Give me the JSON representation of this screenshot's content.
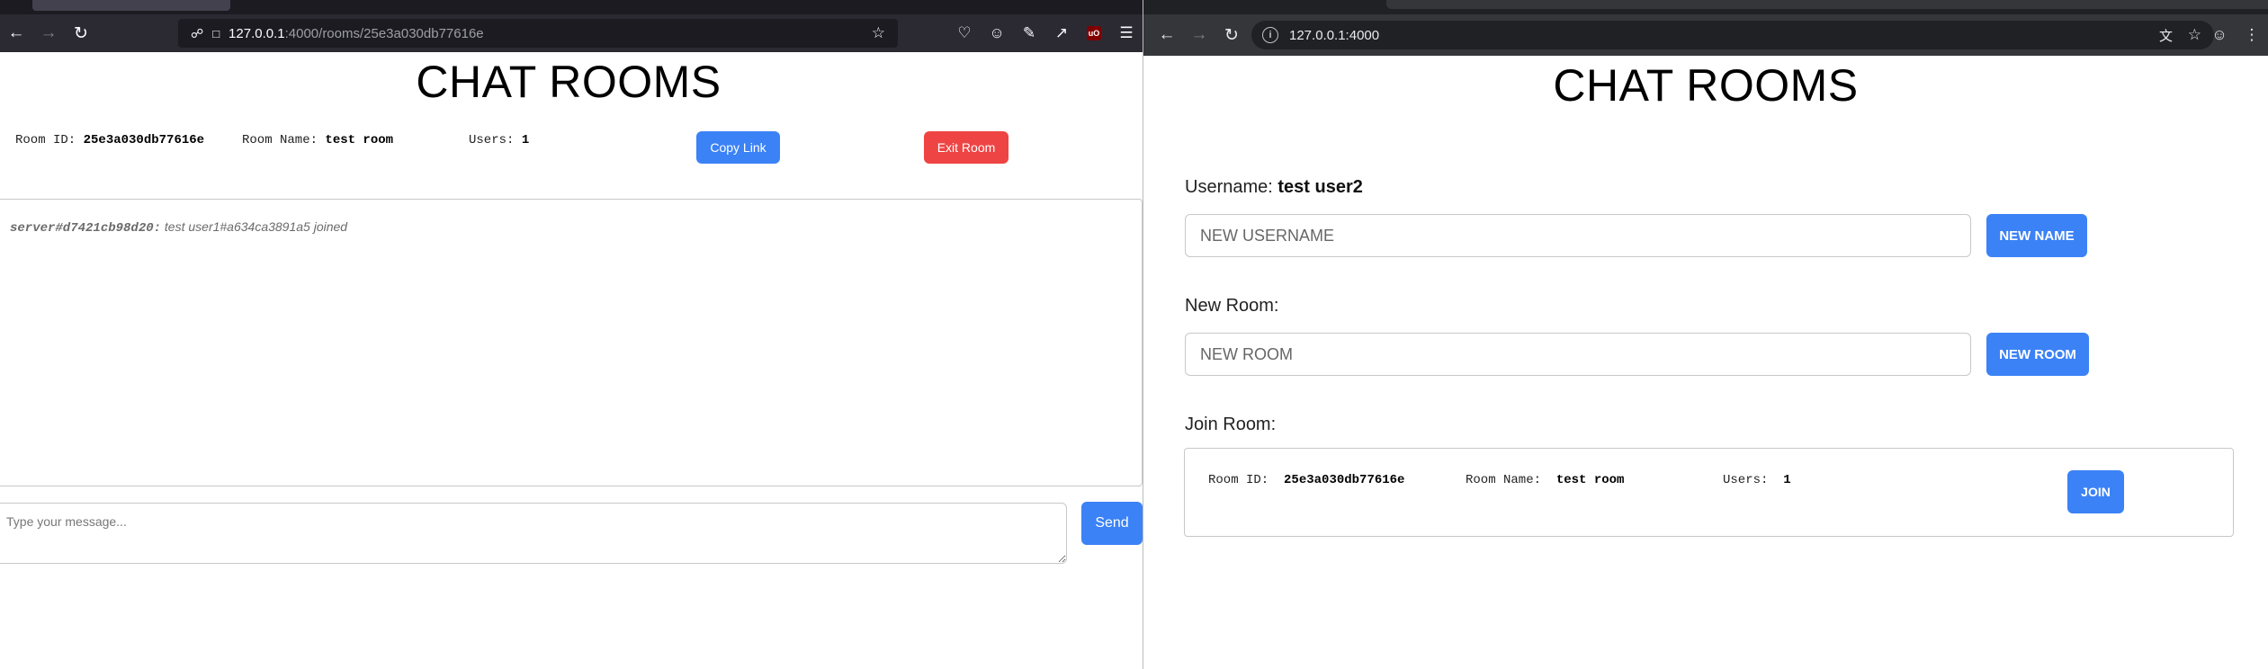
{
  "left_browser": {
    "url_host": "127.0.0.1",
    "url_path": ":4000/rooms/25e3a030db77616e"
  },
  "left_page": {
    "title": "CHAT ROOMS",
    "room_id_label": "Room ID:",
    "room_id": "25e3a030db77616e",
    "room_name_label": "Room Name:",
    "room_name": "test room",
    "users_label": "Users:",
    "users_count": "1",
    "copy_link_label": "Copy Link",
    "exit_room_label": "Exit Room",
    "messages": [
      {
        "sender": "server#d7421cb98d20:",
        "text": "test user1#a634ca3891a5 joined"
      }
    ],
    "message_placeholder": "Type your message...",
    "send_label": "Send"
  },
  "right_browser": {
    "url": "127.0.0.1:4000"
  },
  "right_page": {
    "title": "CHAT ROOMS",
    "username_label": "Username:",
    "username_value": "test user2",
    "username_placeholder": "NEW USERNAME",
    "new_name_button": "NEW NAME",
    "new_room_label": "New Room:",
    "new_room_placeholder": "NEW ROOM",
    "new_room_button": "NEW ROOM",
    "join_room_label": "Join Room:",
    "rooms": [
      {
        "room_id_label": "Room ID:",
        "room_id": "25e3a030db77616e",
        "room_name_label": "Room Name:",
        "room_name": "test room",
        "users_label": "Users:",
        "users_count": "1",
        "join_label": "JOIN"
      }
    ]
  },
  "colors": {
    "primary_blue": "#3b82f6",
    "danger_red": "#ef4444"
  }
}
